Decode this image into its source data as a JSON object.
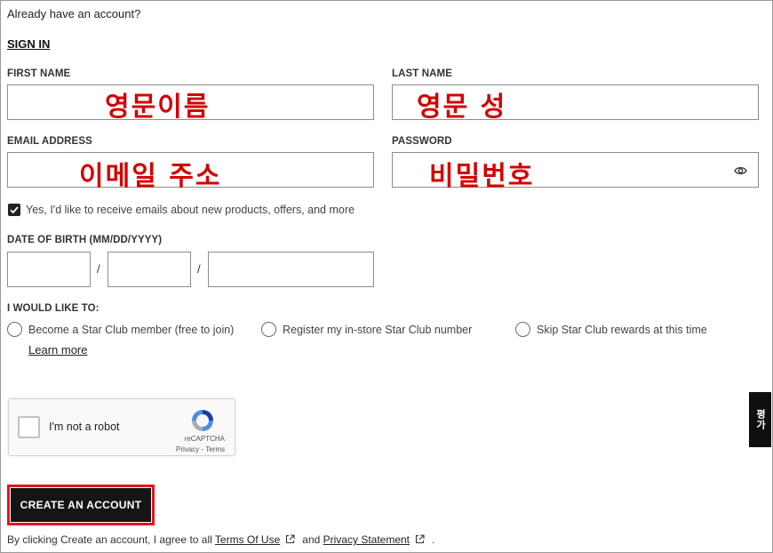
{
  "header": {
    "prompt": "Already have an account?",
    "sign_in": "SIGN IN"
  },
  "fields": {
    "first_name": {
      "label": "FIRST NAME",
      "annotation": "영문이름"
    },
    "last_name": {
      "label": "LAST NAME",
      "annotation": "영문 성"
    },
    "email": {
      "label": "EMAIL ADDRESS",
      "annotation": "이메일 주소"
    },
    "password": {
      "label": "PASSWORD",
      "annotation": "비밀번호"
    }
  },
  "newsletter": {
    "checked": true,
    "label": "Yes, I'd like to receive emails about new products, offers, and more"
  },
  "dob": {
    "label": "DATE OF BIRTH (MM/DD/YYYY)",
    "separator": "/"
  },
  "membership": {
    "label": "I WOULD LIKE TO:",
    "options": [
      "Become a Star Club member (free to join)",
      "Register my in-store Star Club number",
      "Skip Star Club rewards at this time"
    ],
    "learn_more": "Learn more"
  },
  "recaptcha": {
    "text": "I'm not a robot",
    "brand": "reCAPTCHA",
    "privacy": "Privacy",
    "sep": " - ",
    "terms": "Terms"
  },
  "cta": {
    "label": "CREATE AN ACCOUNT",
    "highlight_color": "#e8141a"
  },
  "footer": {
    "prefix": "By clicking Create an account, I agree to all",
    "terms_link": "Terms Of Use",
    "and": "and",
    "privacy_link": "Privacy Statement",
    "suffix": "."
  },
  "side_tab": {
    "label": "평가"
  },
  "colors": {
    "annotation": "#d40000",
    "button_bg": "#151515"
  },
  "icons": {
    "password_toggle": "eye-icon",
    "checkbox": "checkmark-icon",
    "external": "external-link-icon"
  }
}
